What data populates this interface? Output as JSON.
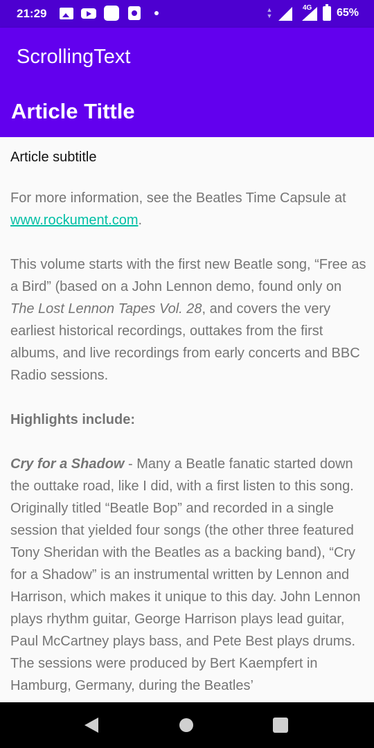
{
  "status_bar": {
    "time": "21:29",
    "network": "4G",
    "battery": "65%"
  },
  "app_bar": {
    "title": "ScrollingText"
  },
  "article": {
    "heading": "Article Tittle",
    "subtitle": "Article subtitle",
    "intro_text": "For more information, see the Beatles Time Capsule at",
    "intro_link": "www.rockument.com",
    "intro_end": ".",
    "para1_a": " This volume starts with the first new Beatle song, “Free as a Bird” (based on a John Lennon demo, found only on ",
    "para1_italic": "The Lost Lennon Tapes Vol. 28",
    "para1_b": ", and covers the very earliest historical recordings, outtakes from the first albums, and live recordings from early concerts and BBC Radio sessions.",
    "highlights_heading": " Highlights include:",
    "para2_title": " Cry for a Shadow",
    "para2_text": " - Many a Beatle fanatic started down the outtake road, like I did, with a first listen to this song. Originally titled “Beatle Bop” and recorded in a single session that yielded four songs (the other three featured Tony Sheridan with the Beatles as a backing band), “Cry for a Shadow” is an instrumental written by Lennon and Harrison, which makes it unique to this day. John Lennon plays rhythm guitar, George Harrison plays lead guitar, Paul McCartney plays bass, and Pete Best plays drums. The sessions were produced by Bert Kaempfert in Hamburg, Germany, during the Beatles’"
  },
  "colors": {
    "status_bar": "#4d00d0",
    "primary": "#6200ee",
    "link": "#00bfa5",
    "body_text": "#757575"
  },
  "icons": {
    "notifications": [
      "gallery-icon",
      "youtube-icon",
      "app-icon",
      "app-icon-2",
      "notification-dot-icon"
    ],
    "status": [
      "data-activity-icon",
      "signal-icon",
      "signal-4g-icon",
      "battery-icon"
    ],
    "navigation": [
      "back-icon",
      "home-icon",
      "recents-icon"
    ]
  }
}
